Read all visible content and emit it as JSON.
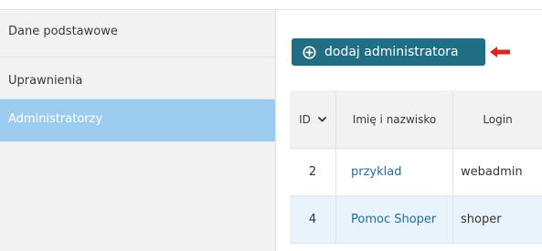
{
  "colors": {
    "sidebar_bg": "#f2f2f2",
    "sidebar_active_bg": "#9ccdf0",
    "button_bg": "#1f6e84",
    "arrow": "#e2231a",
    "link": "#1f6ea8",
    "alt_row_bg": "#e8f3fb"
  },
  "sidebar": {
    "items": [
      {
        "label": "Dane podstawowe",
        "active": false
      },
      {
        "label": "Uprawnienia",
        "active": false
      },
      {
        "label": "Administratorzy",
        "active": true
      }
    ]
  },
  "toolbar": {
    "add_button_label": "dodaj administratora",
    "add_button_icon": "plus-circle-icon",
    "pointer_icon": "arrow-left-icon"
  },
  "table": {
    "columns": [
      {
        "label": "ID",
        "sort_icon": "chevron-down-icon"
      },
      {
        "label": "Imię i nazwisko"
      },
      {
        "label": "Login"
      }
    ],
    "rows": [
      {
        "id": "2",
        "name": "przyklad",
        "login": "webadmin"
      },
      {
        "id": "4",
        "name": "Pomoc Shoper",
        "login": "shoper"
      }
    ]
  }
}
